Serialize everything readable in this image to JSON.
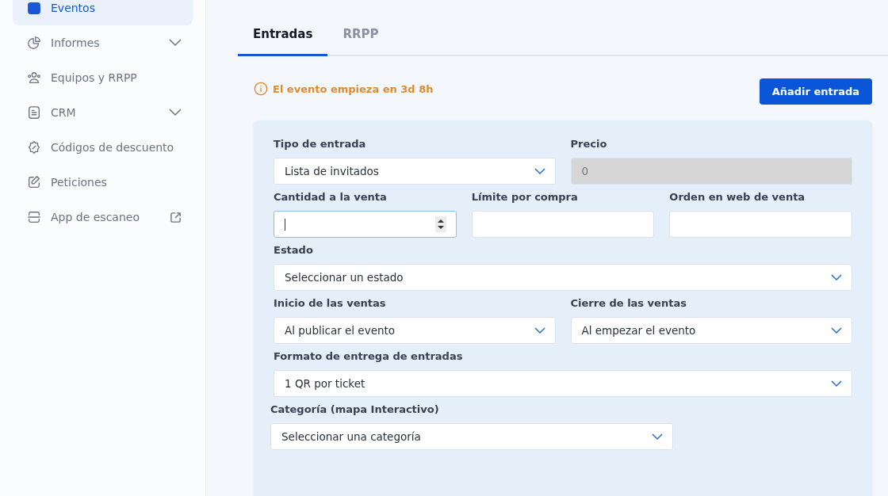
{
  "sidebar": {
    "items": [
      {
        "label": "Eventos",
        "selected": true,
        "submenu": false,
        "external": false
      },
      {
        "label": "Informes",
        "selected": false,
        "submenu": true,
        "external": false
      },
      {
        "label": "Equipos y RRPP",
        "selected": false,
        "submenu": false,
        "external": false
      },
      {
        "label": "CRM",
        "selected": false,
        "submenu": true,
        "external": false
      },
      {
        "label": "Códigos de descuento",
        "selected": false,
        "submenu": false,
        "external": false
      },
      {
        "label": "Peticiones",
        "selected": false,
        "submenu": false,
        "external": false
      },
      {
        "label": "App de escaneo",
        "selected": false,
        "submenu": false,
        "external": true
      }
    ]
  },
  "tabs": [
    {
      "label": "Entradas",
      "selected": true
    },
    {
      "label": "RRPP",
      "selected": false
    }
  ],
  "notice": "El evento empieza en 3d 8h",
  "add_button": "Añadir entrada",
  "form": {
    "rows": [
      {
        "fields": [
          {
            "label": "Tipo de entrada",
            "kind": "select",
            "value": "Lista de invitados",
            "disabled": false,
            "focused": false
          },
          {
            "label": "Precio",
            "kind": "text",
            "value": "0",
            "disabled": true,
            "focused": false
          }
        ]
      },
      {
        "fields": [
          {
            "label": "Cantidad a la venta",
            "kind": "number",
            "disabled": false,
            "focused": true
          },
          {
            "label": "Límite por compra",
            "kind": "text",
            "disabled": false,
            "focused": false
          },
          {
            "label": "Orden en web de venta",
            "kind": "text",
            "disabled": false,
            "focused": false
          }
        ]
      },
      {
        "fields": [
          {
            "label": "Estado",
            "kind": "select",
            "value": "Seleccionar un estado",
            "disabled": false,
            "focused": false
          }
        ]
      },
      {
        "fields": [
          {
            "label": "Inicio de las ventas",
            "kind": "select",
            "value": "Al publicar el evento",
            "disabled": false,
            "focused": false
          },
          {
            "label": "Cierre de las ventas",
            "kind": "select",
            "value": "Al empezar el evento",
            "disabled": false,
            "focused": false
          }
        ]
      },
      {
        "fields": [
          {
            "label": "Formato de entrega de entradas",
            "kind": "select",
            "value": "1 QR por ticket",
            "disabled": false,
            "focused": false
          }
        ]
      },
      {
        "fields": [
          {
            "label": "Categoría (mapa Interactivo)",
            "kind": "select",
            "value": "Seleccionar una categoría",
            "disabled": false,
            "focused": false
          }
        ]
      }
    ]
  }
}
